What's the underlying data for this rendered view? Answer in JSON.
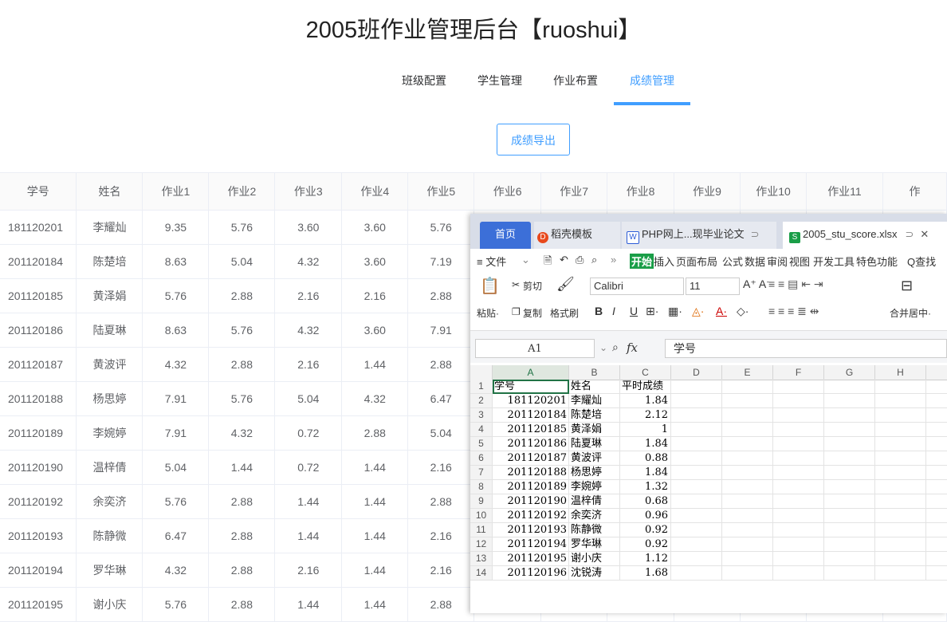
{
  "page_title": "2005班作业管理后台【ruoshui】",
  "nav": [
    "班级配置",
    "学生管理",
    "作业布置",
    "成绩管理"
  ],
  "export_label": "成绩导出",
  "table": {
    "headers": [
      "学号",
      "姓名",
      "作业1",
      "作业2",
      "作业3",
      "作业4",
      "作业5",
      "作业6",
      "作业7",
      "作业8",
      "作业9",
      "作业10",
      "作业11",
      "作"
    ],
    "rows": [
      [
        "181120201",
        "李耀灿",
        "9.35",
        "5.76",
        "3.60",
        "3.60",
        "5.76"
      ],
      [
        "201120184",
        "陈楚培",
        "8.63",
        "5.04",
        "4.32",
        "3.60",
        "7.19"
      ],
      [
        "201120185",
        "黄泽娟",
        "5.76",
        "2.88",
        "2.16",
        "2.16",
        "2.88"
      ],
      [
        "201120186",
        "陆夏琳",
        "8.63",
        "5.76",
        "4.32",
        "3.60",
        "7.91"
      ],
      [
        "201120187",
        "黄波评",
        "4.32",
        "2.88",
        "2.16",
        "1.44",
        "2.88"
      ],
      [
        "201120188",
        "杨思婷",
        "7.91",
        "5.76",
        "5.04",
        "4.32",
        "6.47"
      ],
      [
        "201120189",
        "李婉婷",
        "7.91",
        "4.32",
        "0.72",
        "2.88",
        "5.04"
      ],
      [
        "201120190",
        "温梓倩",
        "5.04",
        "1.44",
        "0.72",
        "1.44",
        "2.16"
      ],
      [
        "201120192",
        "余奕济",
        "5.76",
        "2.88",
        "1.44",
        "1.44",
        "2.88"
      ],
      [
        "201120193",
        "陈静微",
        "6.47",
        "2.88",
        "1.44",
        "1.44",
        "2.16"
      ],
      [
        "201120194",
        "罗华琳",
        "4.32",
        "2.88",
        "2.16",
        "1.44",
        "2.16"
      ],
      [
        "201120195",
        "谢小庆",
        "5.76",
        "2.88",
        "1.44",
        "1.44",
        "2.88"
      ]
    ]
  },
  "wps": {
    "tabs": {
      "home": "首页",
      "templates": "稻壳模板",
      "doc": "PHP网上...现毕业论文",
      "sheet": "2005_stu_score.xlsx"
    },
    "menu": {
      "file": "≡ 文件",
      "start": "开始",
      "insert": "插入",
      "layout": "页面布局",
      "formula": "公式",
      "data": "数据",
      "review": "审阅",
      "view": "视图",
      "dev": "开发工具",
      "special": "特色功能",
      "search": "Q查找"
    },
    "toolbar": {
      "cut": "剪切",
      "paste": "粘贴·",
      "copy": "复制",
      "format_painter": "格式刷",
      "font": "Calibri",
      "font_size": "11",
      "merge": "合并居中·"
    },
    "cell_ref": "A1",
    "fx_label": "fx",
    "formula_value": "学号",
    "columns": [
      "A",
      "B",
      "C",
      "D",
      "E",
      "F",
      "G",
      "H"
    ],
    "rows": [
      [
        "学号",
        "姓名",
        "平时成绩"
      ],
      [
        "181120201",
        "李耀灿",
        "1.84"
      ],
      [
        "201120184",
        "陈楚培",
        "2.12"
      ],
      [
        "201120185",
        "黄泽娟",
        "1"
      ],
      [
        "201120186",
        "陆夏琳",
        "1.84"
      ],
      [
        "201120187",
        "黄波评",
        "0.88"
      ],
      [
        "201120188",
        "杨思婷",
        "1.84"
      ],
      [
        "201120189",
        "李婉婷",
        "1.32"
      ],
      [
        "201120190",
        "温梓倩",
        "0.68"
      ],
      [
        "201120192",
        "余奕济",
        "0.96"
      ],
      [
        "201120193",
        "陈静微",
        "0.92"
      ],
      [
        "201120194",
        "罗华琳",
        "0.92"
      ],
      [
        "201120195",
        "谢小庆",
        "1.12"
      ],
      [
        "201120196",
        "沈锐涛",
        "1.68"
      ]
    ]
  }
}
